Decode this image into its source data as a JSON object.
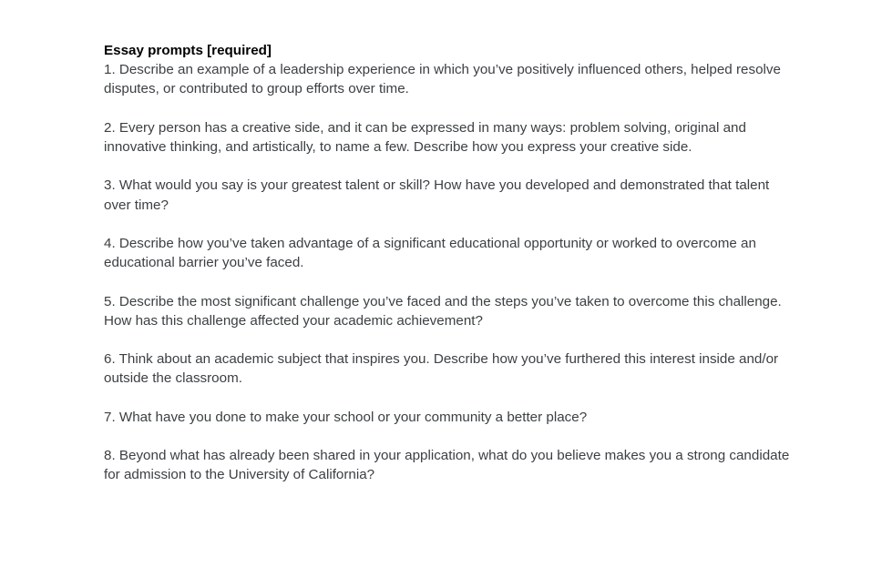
{
  "document": {
    "heading": "Essay prompts [required]",
    "prompts": [
      "1. Describe an example of a leadership experience in which you’ve positively influenced others, helped resolve disputes, or contributed to group efforts over time.",
      "2. Every person has a creative side, and it can be expressed in many ways: problem solving, original and innovative thinking, and artistically, to name a few. Describe how you express your creative side.",
      "3. What would you say is your greatest talent or skill? How have you developed and demonstrated that talent over time?",
      "4. Describe how you’ve taken advantage of a significant educational opportunity or worked to overcome an educational barrier you’ve faced.",
      "5. Describe the most significant challenge you’ve faced and the steps you’ve taken to overcome this challenge. How has this challenge affected your academic achievement?",
      "6. Think about an academic subject that inspires you. Describe how you’ve furthered this interest inside and/or outside the classroom.",
      "7. What have you done to make your school or your community a better place?",
      "8. Beyond what has already been shared in your application, what do you believe makes you a strong candidate for admission to the University of California?"
    ]
  }
}
